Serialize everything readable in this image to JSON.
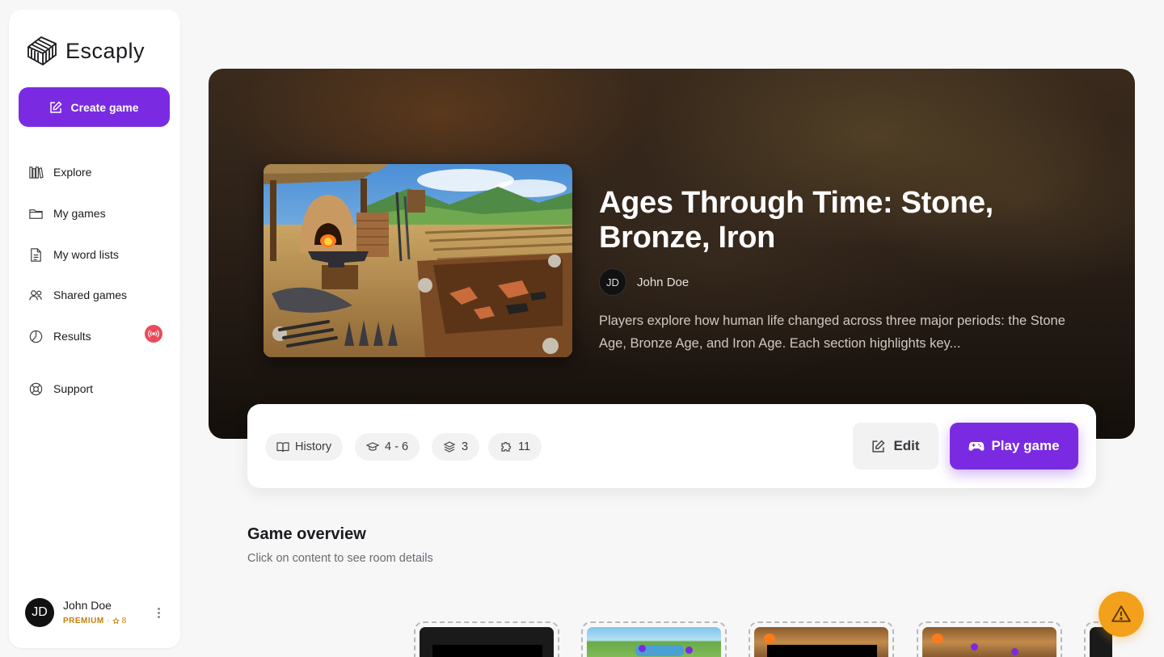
{
  "app": {
    "name": "Escaply"
  },
  "sidebar": {
    "create_label": "Create game",
    "items": [
      {
        "label": "Explore",
        "icon": "books-icon"
      },
      {
        "label": "My games",
        "icon": "folder-icon"
      },
      {
        "label": "My word lists",
        "icon": "document-icon"
      },
      {
        "label": "Shared games",
        "icon": "users-icon"
      },
      {
        "label": "Results",
        "icon": "pie-chart-icon"
      },
      {
        "label": "Support",
        "icon": "lifebuoy-icon"
      }
    ],
    "results_badge_icon": "live-broadcast-icon"
  },
  "user": {
    "initials": "JD",
    "name": "John Doe",
    "plan": "PREMIUM",
    "separator": "·",
    "coins": "8"
  },
  "game": {
    "title": "Ages Through Time: Stone, Bronze, Iron",
    "author_initials": "JD",
    "author_name": "John Doe",
    "description": "Players explore how human life changed across three major periods: the Stone Age, Bronze Age, and Iron Age. Each section highlights key...",
    "chips": {
      "subject": "History",
      "grade": "4 - 6",
      "rooms": "3",
      "puzzles": "11"
    },
    "edit_label": "Edit",
    "play_label": "Play game"
  },
  "overview": {
    "title": "Game overview",
    "subtitle": "Click on content to see room details"
  },
  "colors": {
    "accent": "#7a2be2",
    "badge": "#e94b5a",
    "premium": "#c77d0a",
    "fab": "#f3a11a"
  }
}
